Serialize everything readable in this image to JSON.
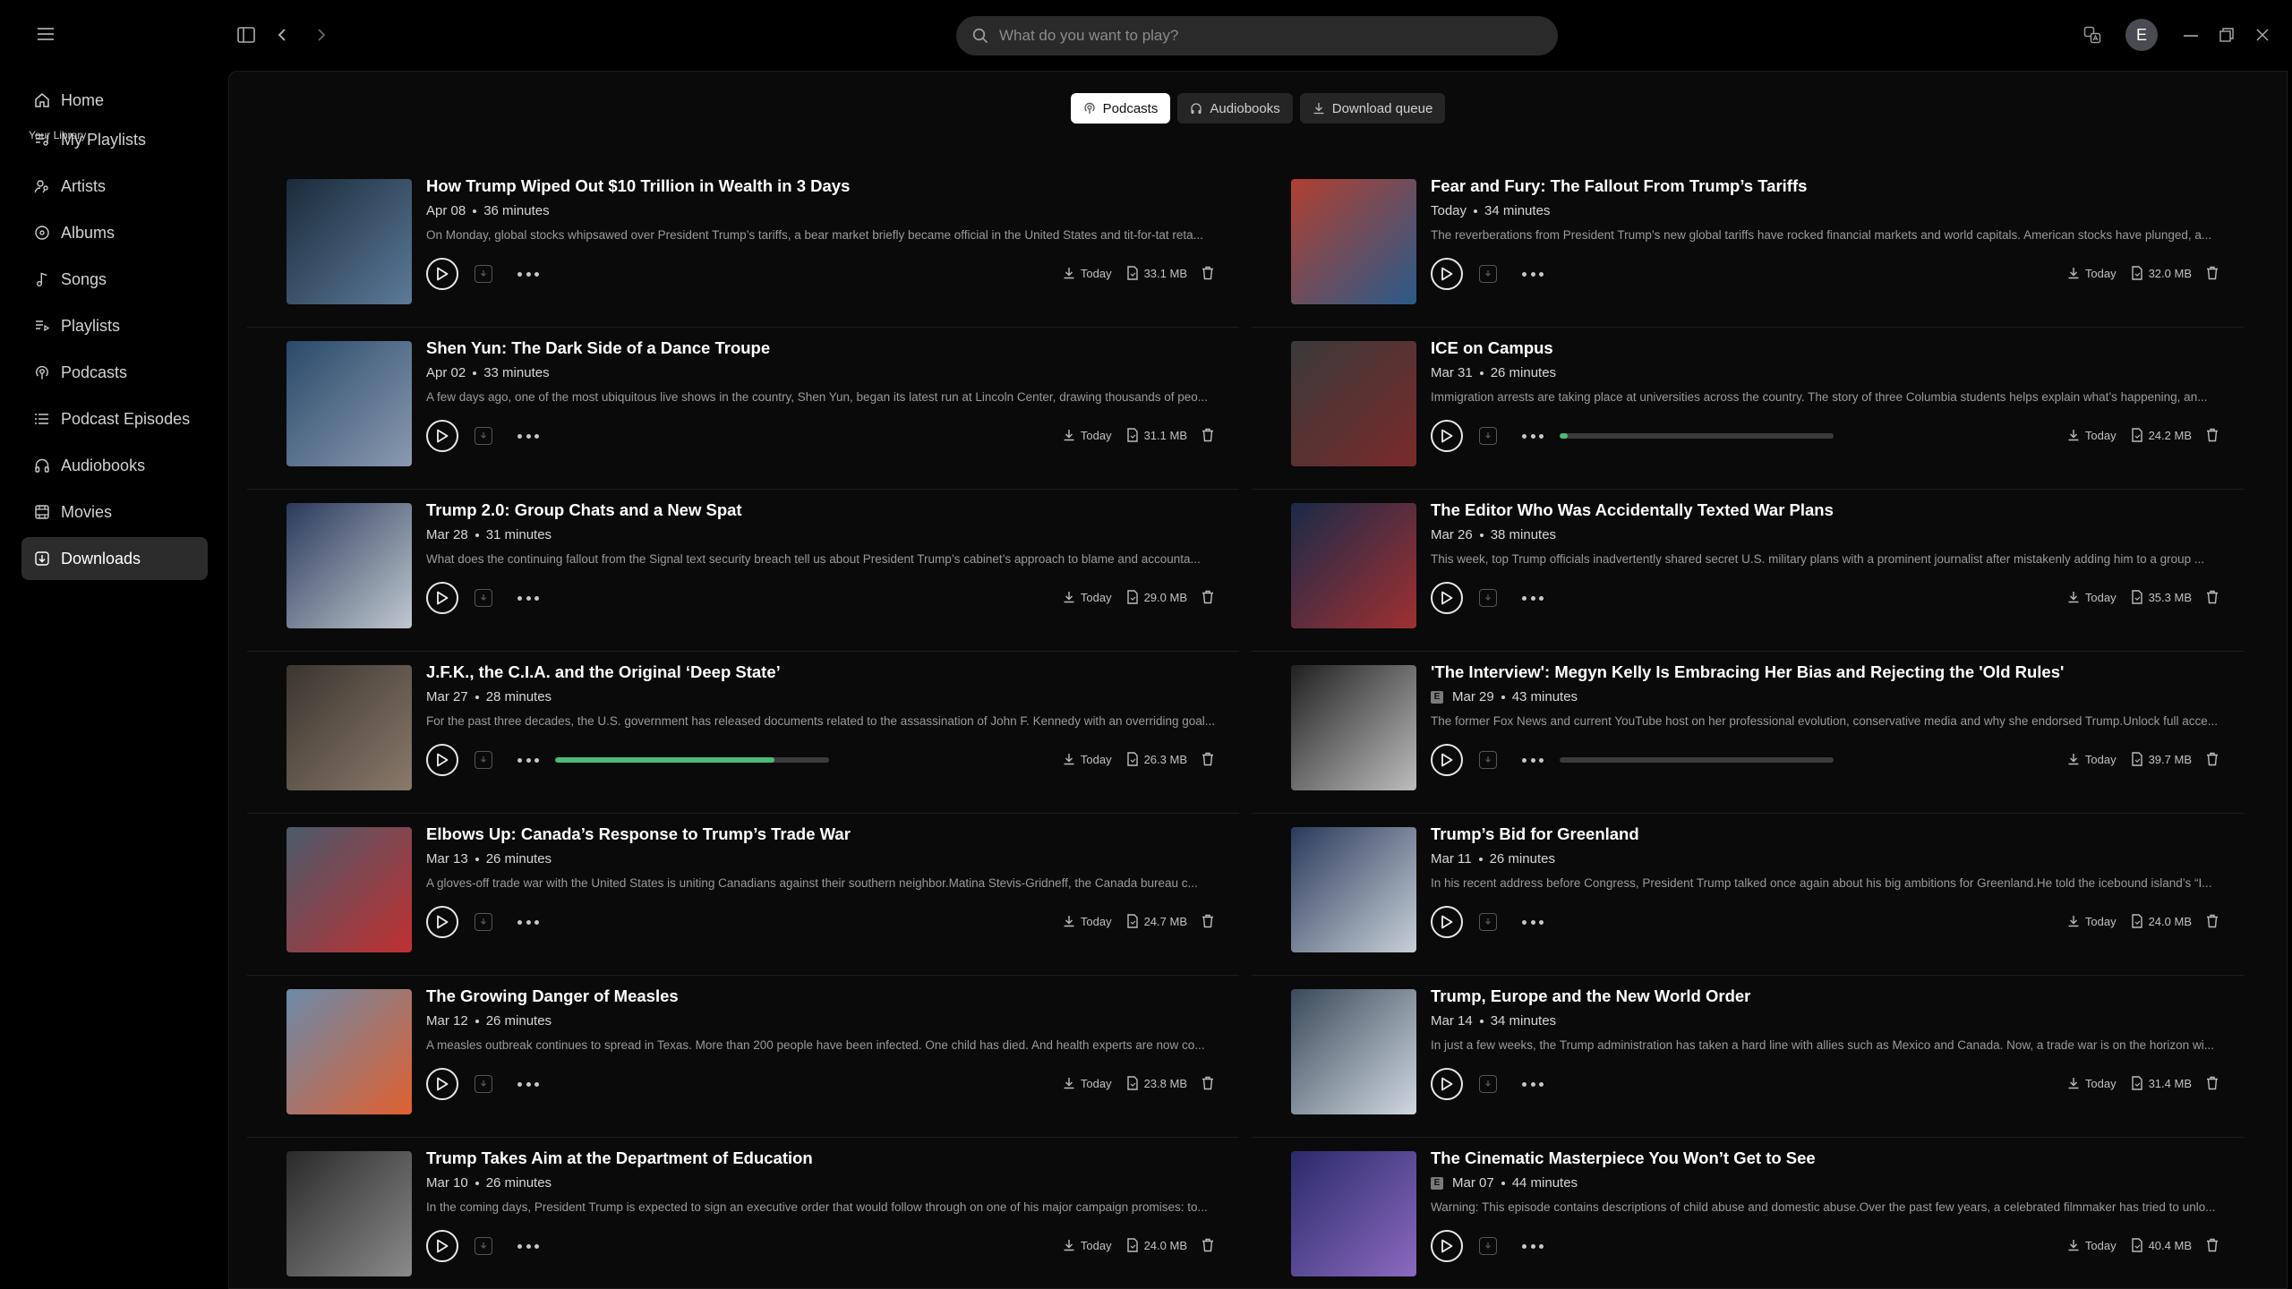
{
  "search": {
    "placeholder": "What do you want to play?"
  },
  "user": {
    "initial": "E"
  },
  "sidebar": {
    "library_heading": "Your Library",
    "home": "Home",
    "items": [
      {
        "label": "My Playlists",
        "icon": "music-note-list-icon"
      },
      {
        "label": "Artists",
        "icon": "person-mic-icon"
      },
      {
        "label": "Albums",
        "icon": "disc-icon"
      },
      {
        "label": "Songs",
        "icon": "music-note-icon"
      },
      {
        "label": "Playlists",
        "icon": "playlist-icon"
      },
      {
        "label": "Podcasts",
        "icon": "podcast-icon"
      },
      {
        "label": "Podcast Episodes",
        "icon": "list-icon"
      },
      {
        "label": "Audiobooks",
        "icon": "headphones-icon"
      },
      {
        "label": "Movies",
        "icon": "film-icon"
      },
      {
        "label": "Downloads",
        "icon": "download-icon",
        "active": true
      }
    ]
  },
  "tabs": [
    {
      "label": "Podcasts",
      "active": true
    },
    {
      "label": "Audiobooks"
    },
    {
      "label": "Download queue"
    }
  ],
  "colors": {
    "accent": "#4dbb72"
  },
  "episodes": [
    {
      "title": "How Trump Wiped Out $10 Trillion in Wealth in 3 Days",
      "date": "Apr 08",
      "duration": "36 minutes",
      "desc": "On Monday, global stocks whipsawed over President Trump’s tariffs, a bear market briefly became official in the United States and tit-for-tat reta...",
      "downloaded": "Today",
      "size": "33.1 MB",
      "explicit": false,
      "progress": null
    },
    {
      "title": "Fear and Fury: The Fallout From Trump’s Tariffs",
      "date": "Today",
      "duration": "34 minutes",
      "desc": "The reverberations from President Trump’s new global tariffs have rocked financial markets and world capitals. American stocks have plunged, a...",
      "downloaded": "Today",
      "size": "32.0 MB",
      "explicit": false,
      "progress": null
    },
    {
      "title": "Shen Yun: The Dark Side of a Dance Troupe",
      "date": "Apr 02",
      "duration": "33 minutes",
      "desc": "A few days ago, one of the most ubiquitous live shows in the country, Shen Yun, began its latest run at Lincoln Center, drawing thousands of peo...",
      "downloaded": "Today",
      "size": "31.1 MB",
      "explicit": false,
      "progress": null
    },
    {
      "title": "ICE on Campus",
      "date": "Mar 31",
      "duration": "26 minutes",
      "desc": "Immigration arrests are taking place at universities across the country. The story of three Columbia students helps explain what’s happening, an...",
      "downloaded": "Today",
      "size": "24.2 MB",
      "explicit": false,
      "progress": 0.03
    },
    {
      "title": "Trump 2.0: Group Chats and a New Spat",
      "date": "Mar 28",
      "duration": "31 minutes",
      "desc": "What does the continuing fallout from the Signal text security breach tell us about President Trump’s cabinet’s approach to blame and accounta...",
      "downloaded": "Today",
      "size": "29.0 MB",
      "explicit": false,
      "progress": null
    },
    {
      "title": "The Editor Who Was Accidentally Texted War Plans",
      "date": "Mar 26",
      "duration": "38 minutes",
      "desc": "This week, top Trump officials inadvertently shared secret U.S. military plans with a prominent journalist after mistakenly adding him to a group ...",
      "downloaded": "Today",
      "size": "35.3 MB",
      "explicit": false,
      "progress": null
    },
    {
      "title": "J.F.K., the C.I.A. and the Original ‘Deep State’",
      "date": "Mar 27",
      "duration": "28 minutes",
      "desc": "For the past three decades, the U.S. government has released documents related to the assassination of John F. Kennedy with an overriding goal...",
      "downloaded": "Today",
      "size": "26.3 MB",
      "explicit": false,
      "progress": 0.8
    },
    {
      "title": "'The Interview': Megyn Kelly Is Embracing Her Bias and Rejecting the 'Old Rules'",
      "date": "Mar 29",
      "duration": "43 minutes",
      "desc": "The former Fox News and current YouTube host on her professional evolution, conservative media and why she endorsed Trump.Unlock full acce...",
      "downloaded": "Today",
      "size": "39.7 MB",
      "explicit": true,
      "progress": 0.0
    },
    {
      "title": "Elbows Up: Canada’s Response to Trump’s Trade War",
      "date": "Mar 13",
      "duration": "26 minutes",
      "desc": "A gloves-off trade war with the United States is uniting Canadians against their southern neighbor.Matina Stevis-Gridneff, the Canada bureau c...",
      "downloaded": "Today",
      "size": "24.7 MB",
      "explicit": false,
      "progress": null
    },
    {
      "title": "Trump’s Bid for Greenland",
      "date": "Mar 11",
      "duration": "26 minutes",
      "desc": "In his recent address before Congress, President Trump talked once again about his big ambitions for Greenland.He told the icebound island’s “I...",
      "downloaded": "Today",
      "size": "24.0 MB",
      "explicit": false,
      "progress": null
    },
    {
      "title": "The Growing Danger of Measles",
      "date": "Mar 12",
      "duration": "26 minutes",
      "desc": "A measles outbreak continues to spread in Texas. More than 200 people have been infected. One child has died. And health experts are now co...",
      "downloaded": "Today",
      "size": "23.8 MB",
      "explicit": false,
      "progress": null
    },
    {
      "title": "Trump, Europe and the New World Order",
      "date": "Mar 14",
      "duration": "34 minutes",
      "desc": "In just a few weeks, the Trump administration has taken a hard line with allies such as Mexico and Canada. Now, a trade war is on the horizon wi...",
      "downloaded": "Today",
      "size": "31.4 MB",
      "explicit": false,
      "progress": null
    },
    {
      "title": "Trump Takes Aim at the Department of Education",
      "date": "Mar 10",
      "duration": "26 minutes",
      "desc": "In the coming days, President Trump is expected to sign an executive order that would follow through on one of his major campaign promises: to...",
      "downloaded": "Today",
      "size": "24.0 MB",
      "explicit": false,
      "progress": null
    },
    {
      "title": "The Cinematic Masterpiece You Won’t Get to See",
      "date": "Mar 07",
      "duration": "44 minutes",
      "desc": "Warning: This episode contains descriptions of child abuse and domestic abuse.Over the past few years, a celebrated filmmaker has tried to unlo...",
      "downloaded": "Today",
      "size": "40.4 MB",
      "explicit": true,
      "progress": null
    }
  ]
}
